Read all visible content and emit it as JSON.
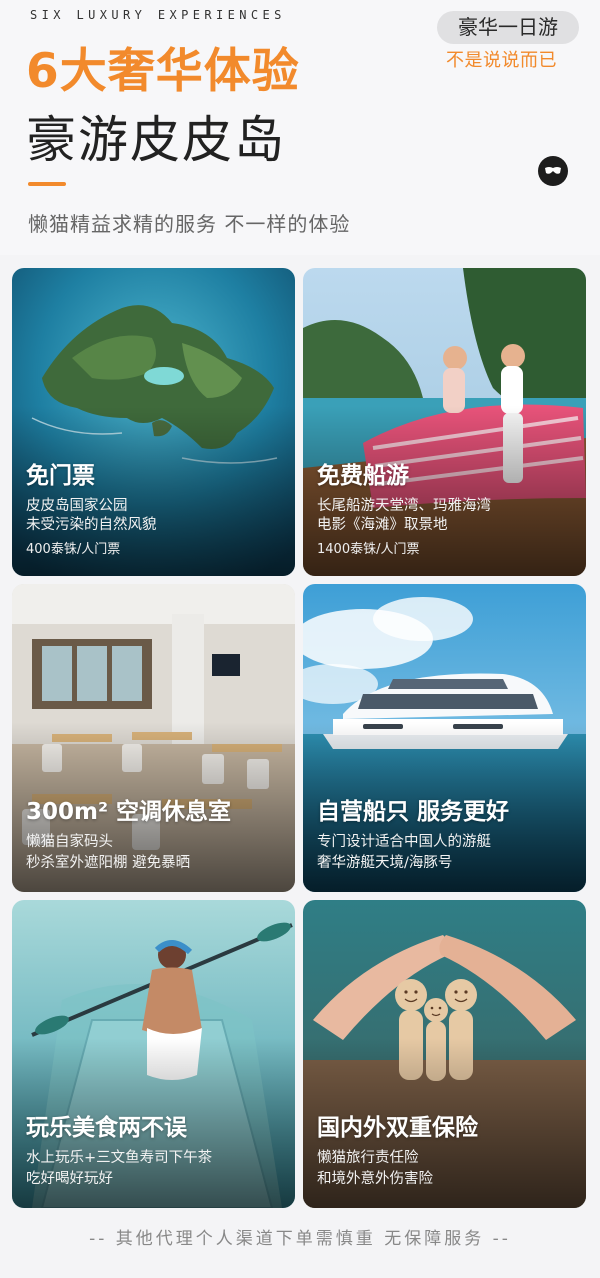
{
  "header": {
    "eyebrow": "SIX LUXURY EXPERIENCES",
    "title_orange": "6大奢华体验",
    "title_dark": "豪游皮皮岛",
    "subtitle": "懒猫精益求精的服务 不一样的体验",
    "badge": "豪华一日游",
    "badge_sub": "不是说说而已",
    "accent_color": "#f28a2c"
  },
  "cards": [
    {
      "title": "免门票",
      "lines": [
        "皮皮岛国家公园",
        "未受污染的自然风貌"
      ],
      "price": "400泰铢/人门票",
      "icon": "island-photo"
    },
    {
      "title": "免费船游",
      "lines": [
        "长尾船游天堂湾、玛雅海湾",
        "电影《海滩》取景地"
      ],
      "price": "1400泰铢/人门票",
      "icon": "longtail-boat-photo"
    },
    {
      "title": "300m² 空调休息室",
      "lines": [
        "懒猫自家码头",
        "秒杀室外遮阳棚   避免暴晒"
      ],
      "price": "",
      "icon": "lounge-photo"
    },
    {
      "title": "自营船只 服务更好",
      "lines": [
        "专门设计适合中国人的游艇",
        "奢华游艇天境/海豚号"
      ],
      "price": "",
      "icon": "yacht-photo"
    },
    {
      "title": "玩乐美食两不误",
      "lines": [
        "水上玩乐+三文鱼寿司下午茶",
        "吃好喝好玩好"
      ],
      "price": "",
      "icon": "kayak-photo"
    },
    {
      "title": "国内外双重保险",
      "lines": [
        "懒猫旅行责任险",
        "和境外意外伤害险"
      ],
      "price": "",
      "icon": "insurance-photo"
    }
  ],
  "footer": {
    "note": "-- 其他代理个人渠道下单需慎重 无保障服务 --"
  }
}
